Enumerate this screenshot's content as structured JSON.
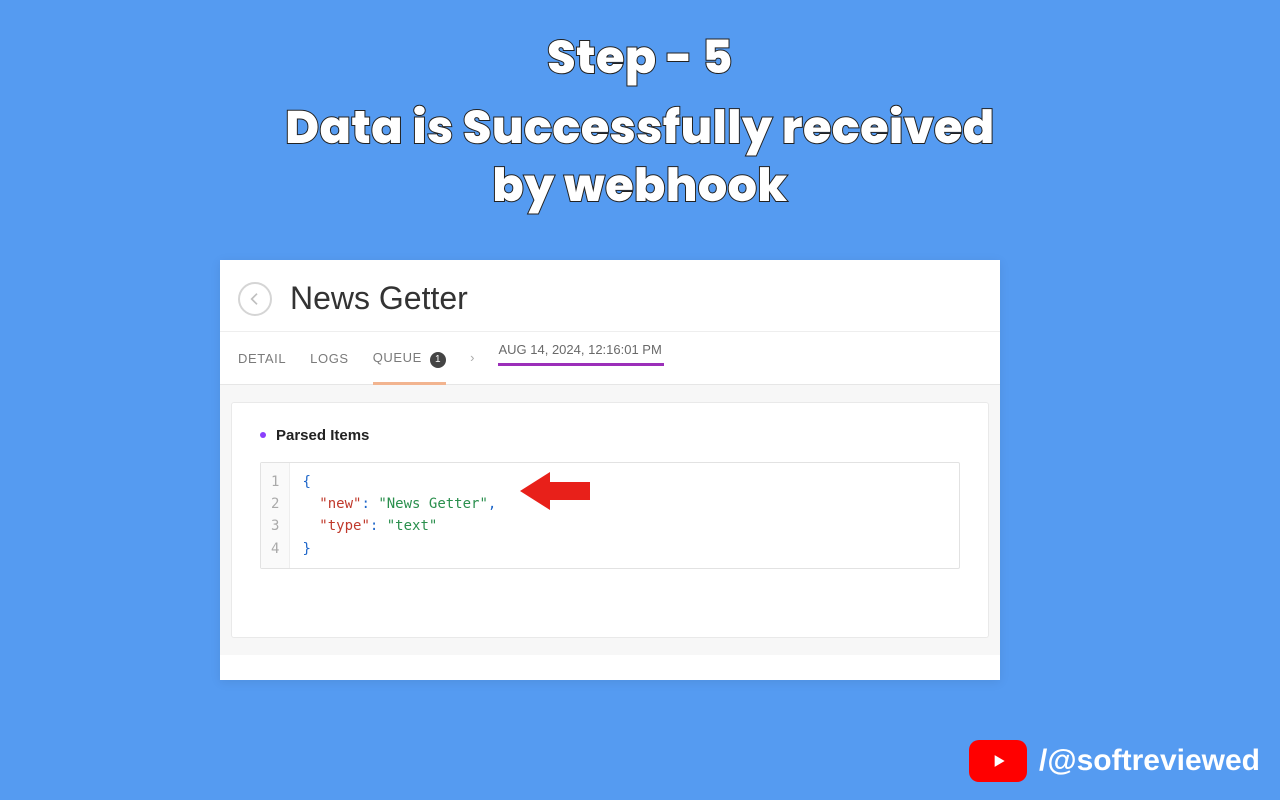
{
  "overlay": {
    "step_title": "Step - 5",
    "subtitle_line1": "Data is Successfully received",
    "subtitle_line2": "by webhook"
  },
  "app": {
    "title": "News Getter",
    "tabs": {
      "detail": "DETAIL",
      "logs": "LOGS",
      "queue": "QUEUE",
      "queue_badge": "1",
      "timestamp": "AUG 14, 2024, 12:16:01 PM"
    },
    "section_header": "Parsed Items",
    "code": {
      "lines": [
        "1",
        "2",
        "3",
        "4"
      ],
      "line1_open": "{",
      "line2_key": "\"new\"",
      "line2_val": "\"News Getter\"",
      "line2_comma": ",",
      "line3_key": "\"type\"",
      "line3_val": "\"text\"",
      "line4_close": "}"
    }
  },
  "watermark": {
    "handle": "/@softreviewed"
  }
}
